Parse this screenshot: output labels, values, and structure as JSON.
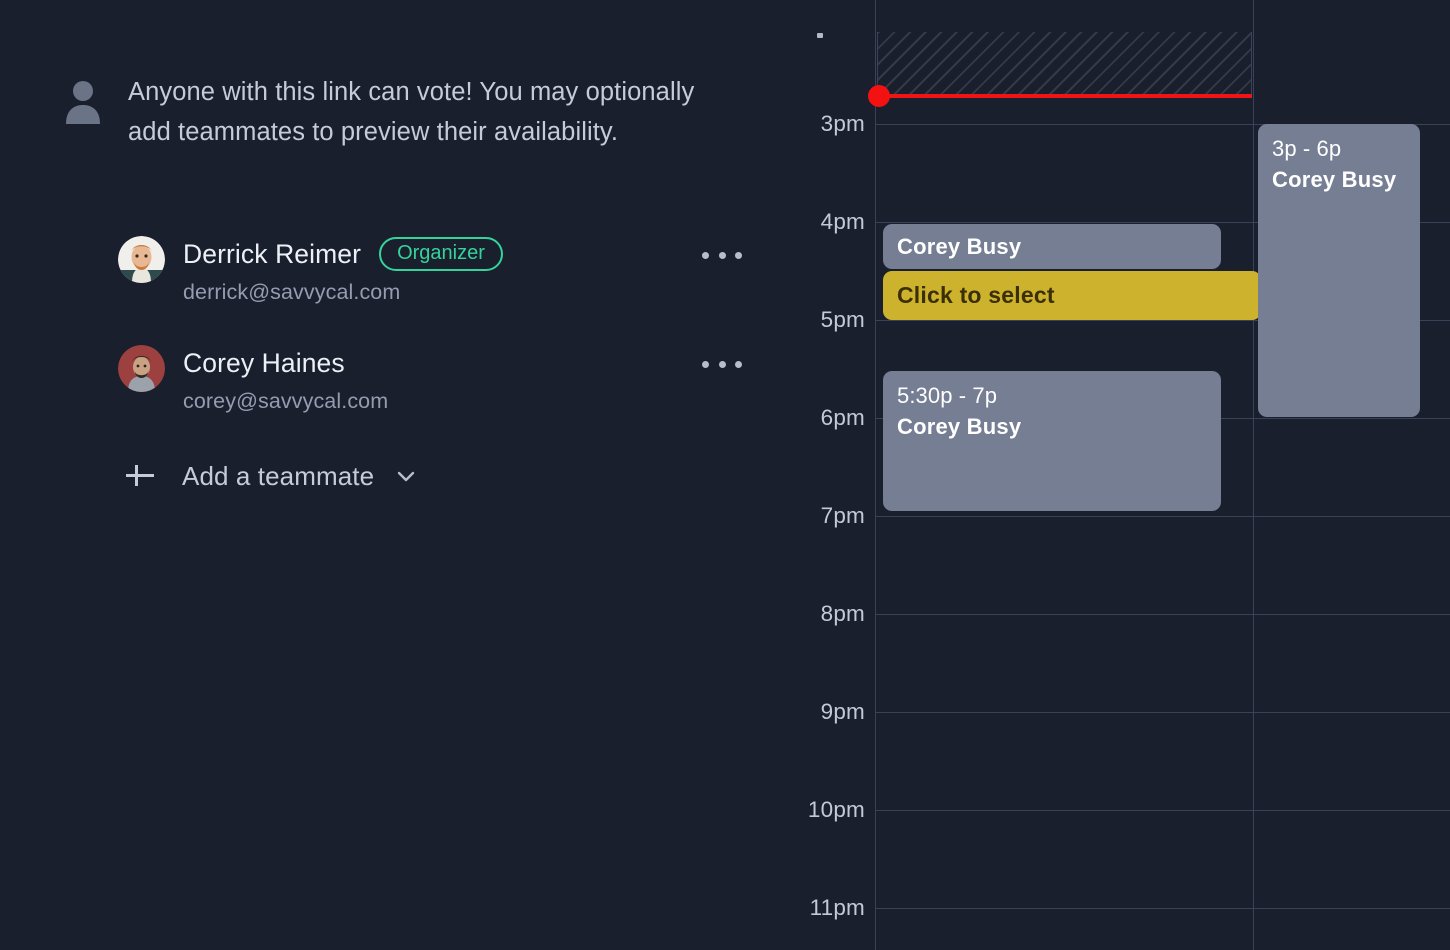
{
  "notice": {
    "icon": "person-icon",
    "text": "Anyone with this link can vote! You may optionally add teammates to preview their availability."
  },
  "participants": [
    {
      "name": "Derrick Reimer",
      "email": "derrick@savvycal.com",
      "badge": "Organizer",
      "badge_color": "#35d399",
      "avatar": "derrick-avatar",
      "menu_icon": "kebab-menu-icon"
    },
    {
      "name": "Corey Haines",
      "email": "corey@savvycal.com",
      "badge": null,
      "avatar": "corey-avatar",
      "menu_icon": "kebab-menu-icon"
    }
  ],
  "add_teammate": {
    "label": "Add a teammate",
    "plus_icon": "plus-icon",
    "chevron_icon": "chevron-down-icon"
  },
  "calendar": {
    "hour_labels": [
      "3pm",
      "4pm",
      "5pm",
      "6pm",
      "7pm",
      "8pm",
      "9pm",
      "10pm",
      "11pm"
    ],
    "now_indicator_color": "#f41111",
    "busy_color": "#767e94",
    "select_color": "#cdb22e",
    "grid_color": "#3a4257",
    "events": [
      {
        "id": "corey-busy-4pm",
        "time": "",
        "title": "Corey Busy",
        "kind": "busy"
      },
      {
        "id": "click-to-select",
        "time": "",
        "title": "Click to select",
        "kind": "select"
      },
      {
        "id": "corey-busy-530",
        "time": "5:30p - 7p",
        "title": "Corey Busy",
        "kind": "busy"
      },
      {
        "id": "corey-busy-3p-6p",
        "time": "3p - 6p",
        "title": "Corey Busy",
        "kind": "busy"
      }
    ]
  }
}
